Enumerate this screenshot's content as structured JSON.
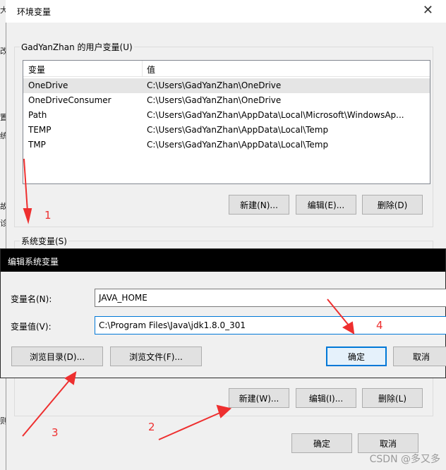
{
  "background": {
    "chars": [
      "大",
      "改",
      "置",
      "统",
      "故",
      "诊",
      "则"
    ]
  },
  "window": {
    "title": "环境变量",
    "close_glyph": "✕",
    "user_group_label": "GadYanZhan 的用户变量(U)",
    "columns": [
      "变量",
      "值"
    ],
    "user_vars": [
      {
        "name": "OneDrive",
        "value": "C:\\Users\\GadYanZhan\\OneDrive"
      },
      {
        "name": "OneDriveConsumer",
        "value": "C:\\Users\\GadYanZhan\\OneDrive"
      },
      {
        "name": "Path",
        "value": "C:\\Users\\GadYanZhan\\AppData\\Local\\Microsoft\\WindowsAp..."
      },
      {
        "name": "TEMP",
        "value": "C:\\Users\\GadYanZhan\\AppData\\Local\\Temp"
      },
      {
        "name": "TMP",
        "value": "C:\\Users\\GadYanZhan\\AppData\\Local\\Temp"
      }
    ],
    "user_buttons": {
      "new": "新建(N)...",
      "edit": "编辑(E)...",
      "delete": "删除(D)"
    },
    "system_group_label": "系统变量(S)",
    "system_buttons": {
      "new": "新建(W)...",
      "edit": "编辑(I)...",
      "delete": "删除(L)"
    },
    "ok": "确定",
    "cancel": "取消"
  },
  "edit_dialog": {
    "title": "编辑系统变量",
    "name_label": "变量名(N):",
    "name_value": "JAVA_HOME",
    "value_label": "变量值(V):",
    "value_value": "C:\\Program Files\\Java\\jdk1.8.0_301",
    "browse_dir": "浏览目录(D)...",
    "browse_file": "浏览文件(F)...",
    "ok": "确定",
    "cancel": "取消"
  },
  "annotations": {
    "color": "#ee2f2f",
    "labels": [
      "1",
      "2",
      "3",
      "4"
    ]
  },
  "watermark": "CSDN @多又多"
}
